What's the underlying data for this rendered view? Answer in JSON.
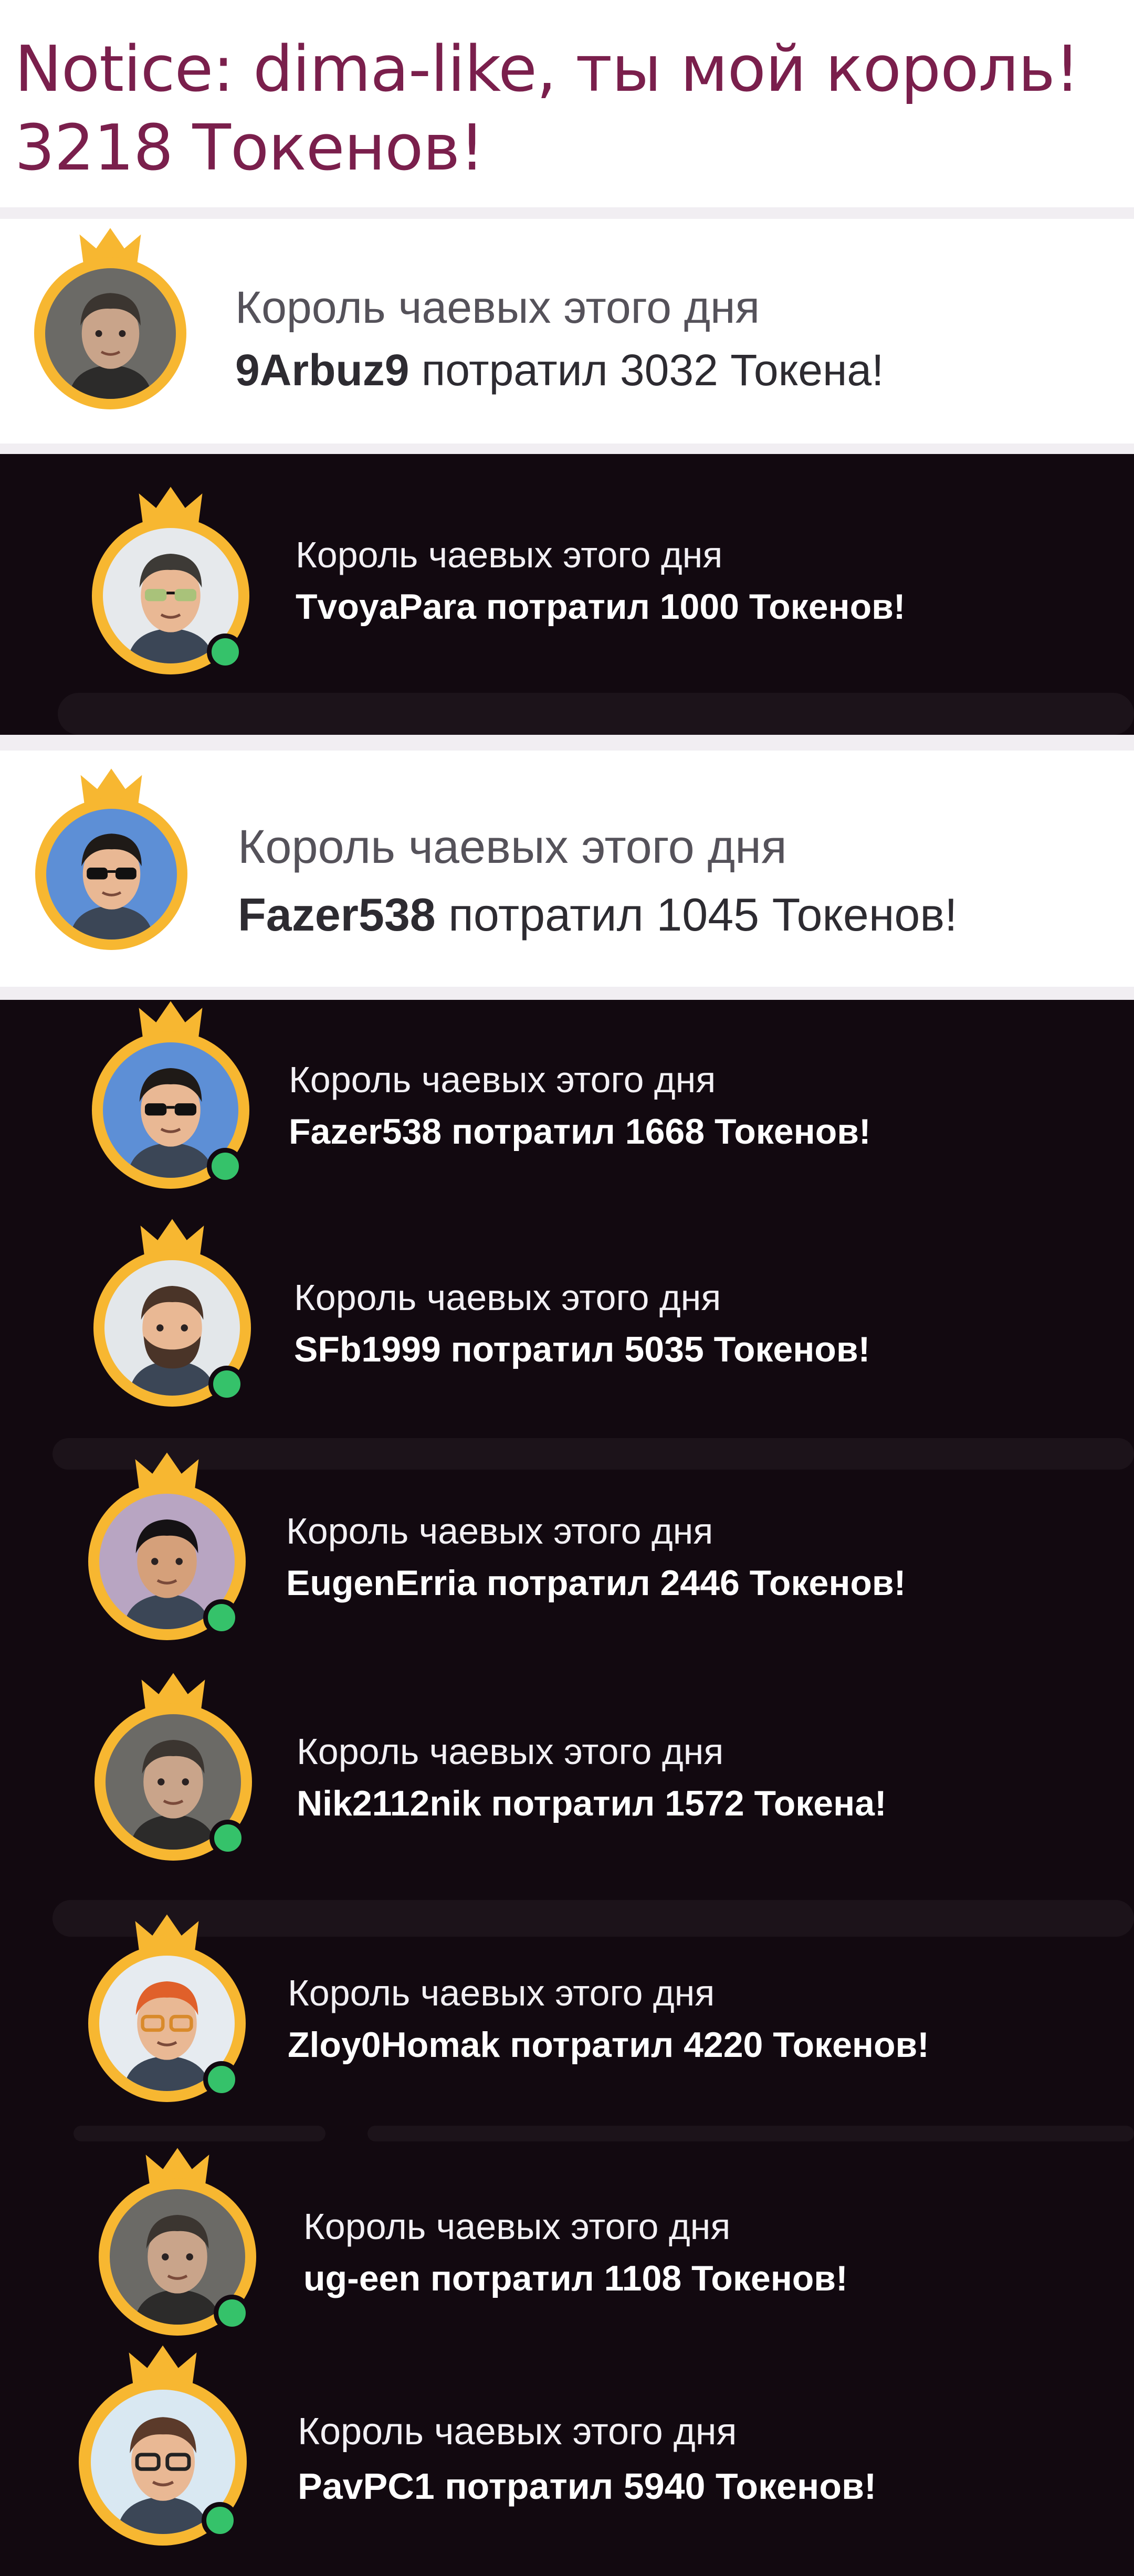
{
  "notice": {
    "line1": "Notice: dima-like, ты мой король!",
    "line2": "3218 Токенов!"
  },
  "king_caption": "Король чаевых этого дня",
  "verb": "потратил",
  "colors": {
    "notice_text": "#7a1f4c",
    "dark_bg": "#120910",
    "crown_ring": "#f7b731",
    "online_dot": "#35c26a"
  },
  "entries": [
    {
      "user": "9Arbuz9",
      "amount": "3032",
      "unit": "Токена!",
      "theme": "light",
      "online": false,
      "avatar": "photo-avatar"
    },
    {
      "user": "TvoyaPara",
      "amount": "1000",
      "unit": "Токенов!",
      "theme": "dark",
      "online": true,
      "avatar": "sunglasses-avatar"
    },
    {
      "user": "Fazer538",
      "amount": "1045",
      "unit": "Токенов!",
      "theme": "light",
      "online": false,
      "avatar": "sunglasses-blue-avatar"
    },
    {
      "user": "Fazer538",
      "amount": "1668",
      "unit": "Токенов!",
      "theme": "dark",
      "online": true,
      "avatar": "sunglasses-blue-avatar"
    },
    {
      "user": "SFb1999",
      "amount": "5035",
      "unit": "Токенов!",
      "theme": "dark",
      "online": true,
      "avatar": "bearded-avatar"
    },
    {
      "user": "EugenErria",
      "amount": "2446",
      "unit": "Токенов!",
      "theme": "dark",
      "online": true,
      "avatar": "emo-avatar"
    },
    {
      "user": "Nik2112nik",
      "amount": "1572",
      "unit": "Токена!",
      "theme": "dark",
      "online": true,
      "avatar": "photo-avatar"
    },
    {
      "user": "Zloy0Homak",
      "amount": "4220",
      "unit": "Токенов!",
      "theme": "dark",
      "online": true,
      "avatar": "redhair-avatar"
    },
    {
      "user": "ug-een",
      "amount": "1108",
      "unit": "Токенов!",
      "theme": "dark",
      "online": true,
      "avatar": "photo-avatar"
    },
    {
      "user": "PavPC1",
      "amount": "5940",
      "unit": "Токенов!",
      "theme": "dark",
      "online": true,
      "avatar": "glasses-avatar"
    }
  ]
}
